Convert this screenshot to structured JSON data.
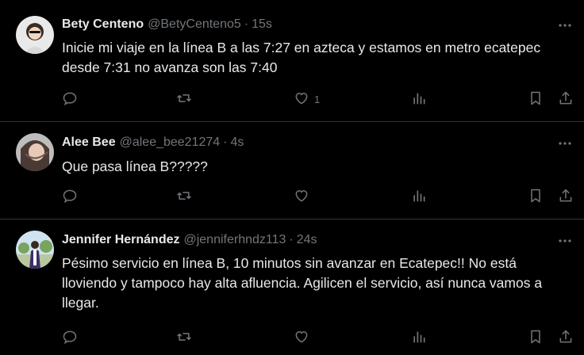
{
  "colors": {
    "background": "#000000",
    "text": "#e7e9ea",
    "muted": "#71767b",
    "divider": "#2f3336"
  },
  "icons": {
    "reply": "reply-icon",
    "repost": "repost-icon",
    "like": "heart-icon",
    "views": "views-icon",
    "bookmark": "bookmark-icon",
    "share": "share-icon",
    "more": "more-icon"
  },
  "posts": [
    {
      "name": "Bety Centeno",
      "handle": "@BetyCenteno5",
      "sep": "·",
      "time": "15s",
      "text": "Inicie mi viaje en la línea B a las 7:27 en azteca y estamos en metro ecatepec desde 7:31 no avanza son las 7:40",
      "likes": "1"
    },
    {
      "name": "Alee Bee",
      "handle": "@alee_bee21274",
      "sep": "·",
      "time": "4s",
      "text": "Que pasa línea B?????",
      "likes": ""
    },
    {
      "name": "Jennifer Hernández",
      "handle": "@jenniferhndz113",
      "sep": "·",
      "time": "24s",
      "text": "Pésimo servicio en línea B, 10 minutos sin avanzar en Ecatepec!! No está lloviendo y tampoco hay alta afluencia. Agilicen el servicio, así nunca vamos a llegar.",
      "likes": ""
    }
  ]
}
